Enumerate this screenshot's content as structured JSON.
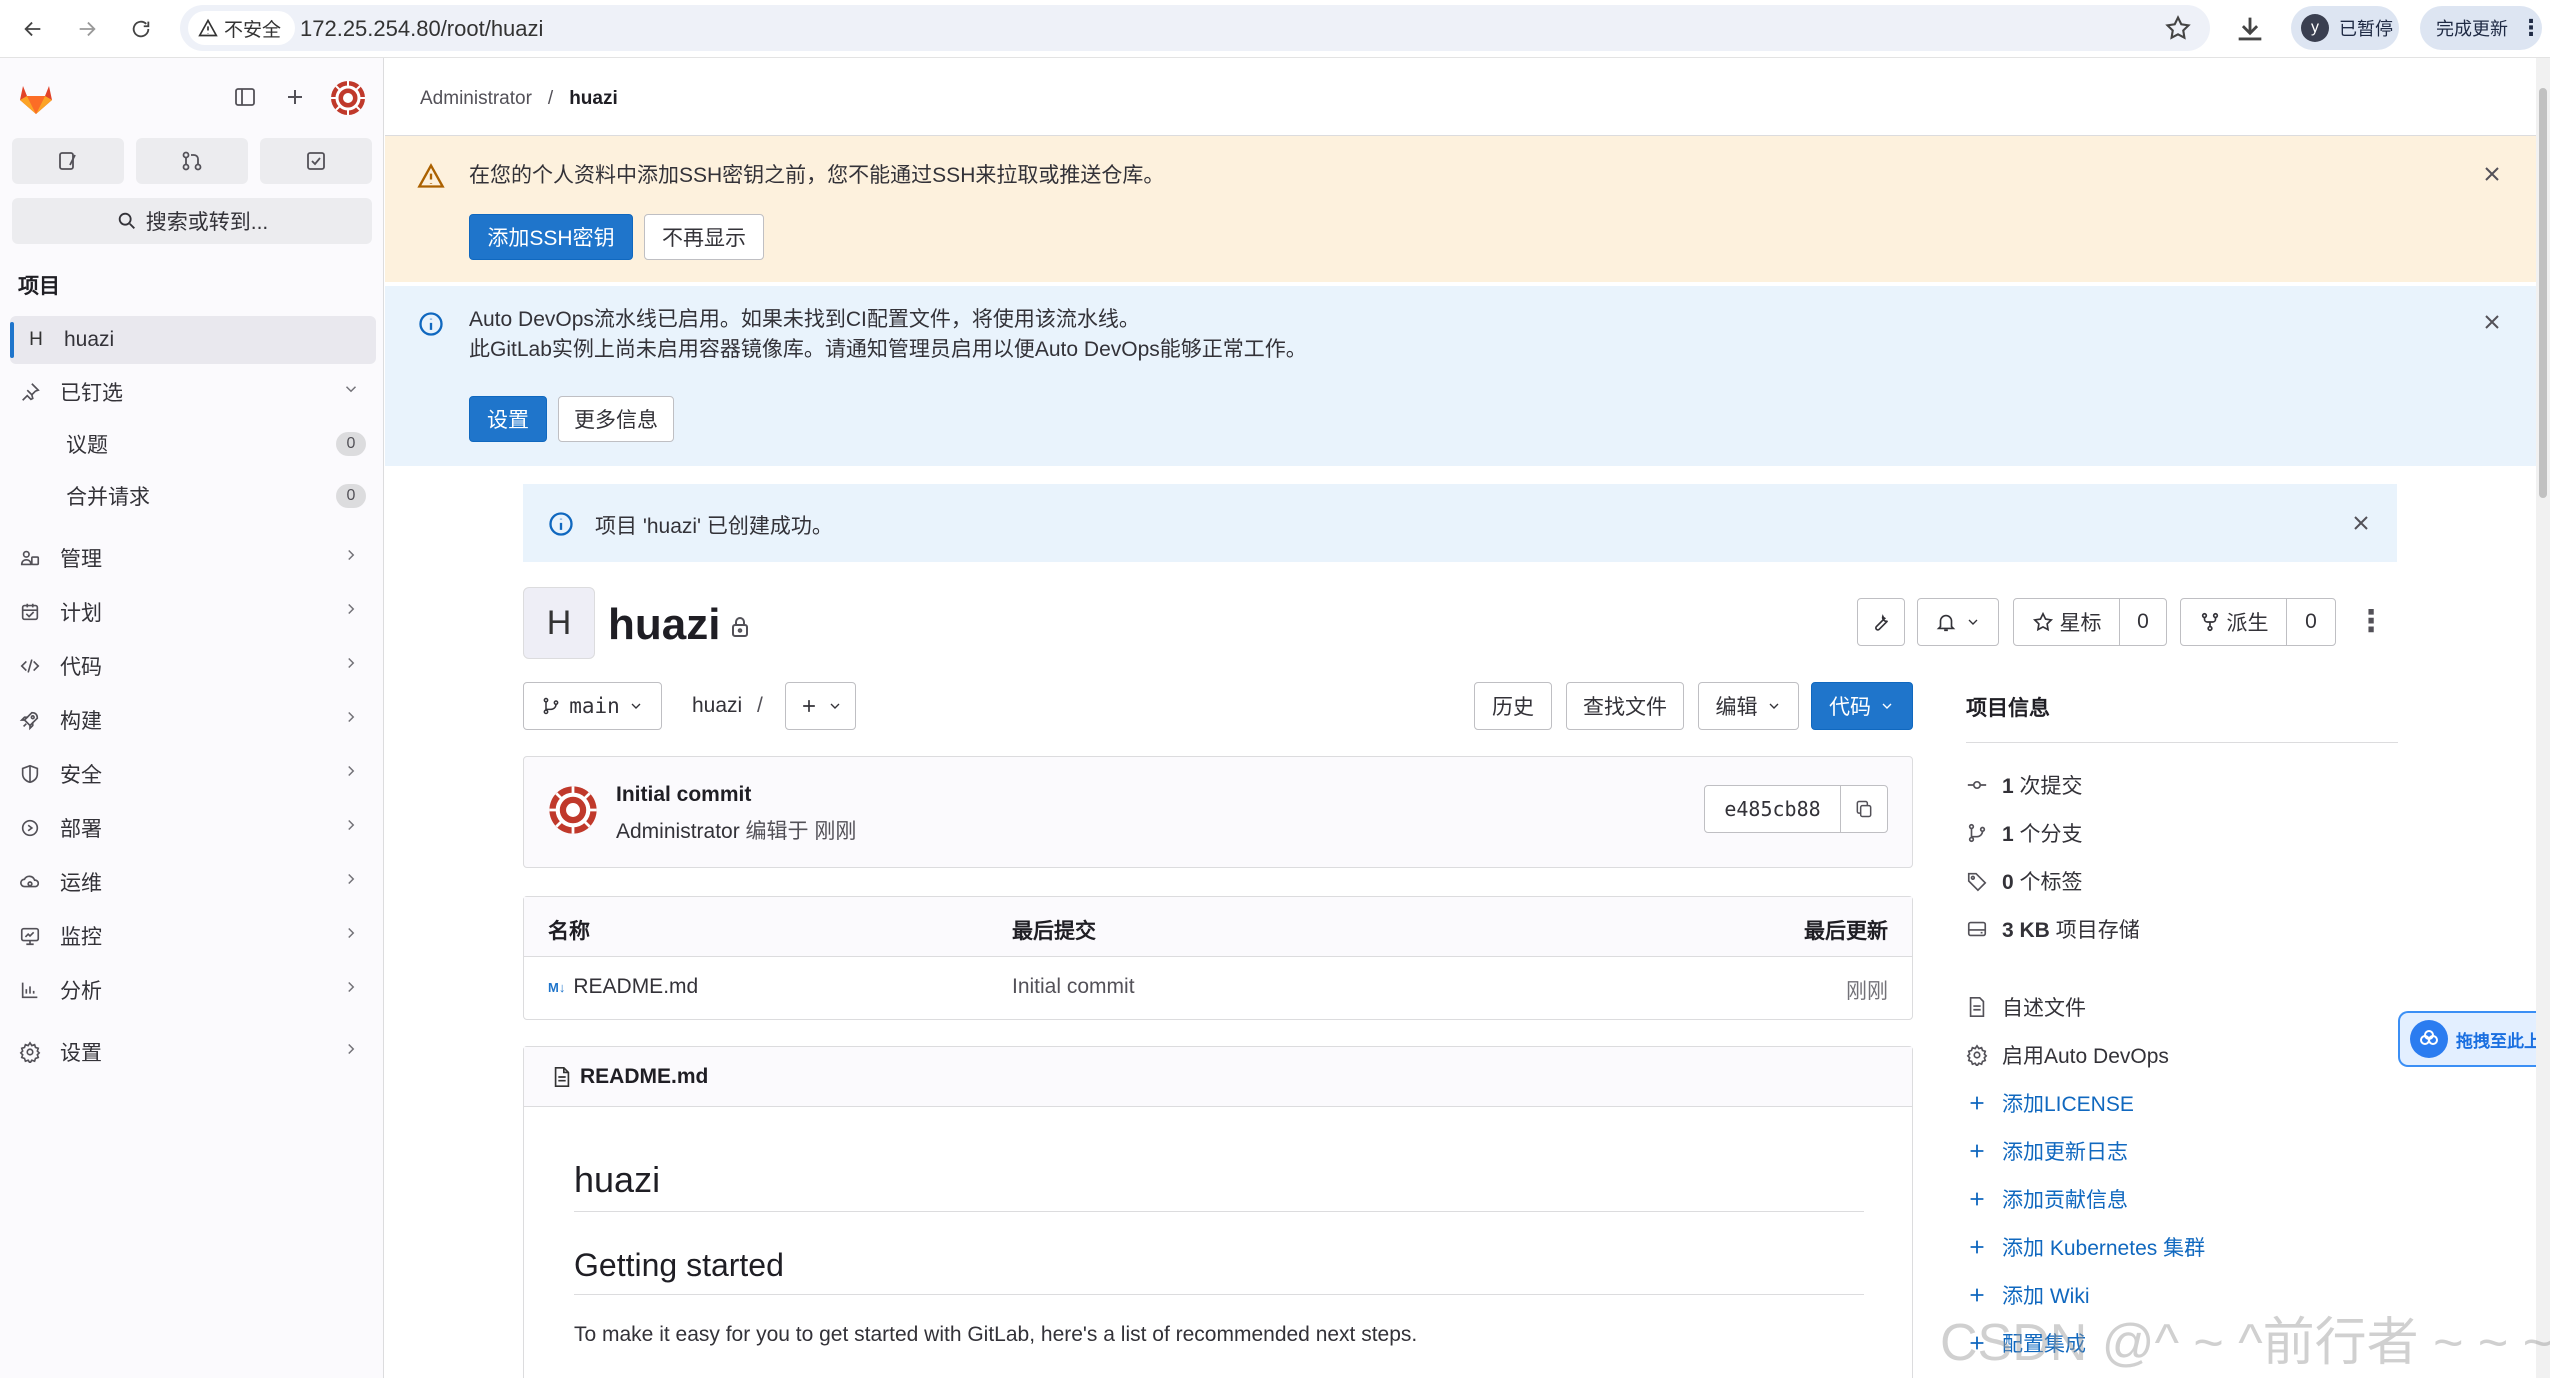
{
  "browser": {
    "security_label": "不安全",
    "url": "172.25.254.80/root/huazi",
    "profile_initial": "y",
    "paused_label": "已暂停",
    "update_label": "完成更新"
  },
  "sidebar": {
    "search_label": "搜索或转到...",
    "section_title": "项目",
    "project": {
      "initial": "H",
      "name": "huazi"
    },
    "pinned_label": "已钉选",
    "pinned_items": [
      {
        "label": "议题",
        "count": "0"
      },
      {
        "label": "合并请求",
        "count": "0"
      }
    ],
    "nav_items": [
      {
        "label": "管理",
        "icon": "users-icon"
      },
      {
        "label": "计划",
        "icon": "calendar-icon"
      },
      {
        "label": "代码",
        "icon": "code-icon"
      },
      {
        "label": "构建",
        "icon": "rocket-icon"
      },
      {
        "label": "安全",
        "icon": "shield-icon"
      },
      {
        "label": "部署",
        "icon": "deploy-icon"
      },
      {
        "label": "运维",
        "icon": "cloud-gear-icon"
      },
      {
        "label": "监控",
        "icon": "monitor-icon"
      },
      {
        "label": "分析",
        "icon": "chart-icon"
      },
      {
        "label": "设置",
        "icon": "gear-icon"
      }
    ]
  },
  "breadcrumb": {
    "parent": "Administrator",
    "separator": "/",
    "current": "huazi"
  },
  "alerts": {
    "ssh": {
      "text": "在您的个人资料中添加SSH密钥之前，您不能通过SSH来拉取或推送仓库。",
      "primary_btn": "添加SSH密钥",
      "secondary_btn": "不再显示"
    },
    "devops": {
      "line1": "Auto DevOps流水线已启用。如果未找到CI配置文件，将使用该流水线。",
      "line2": "此GitLab实例上尚未启用容器镜像库。请通知管理员启用以便Auto DevOps能够正常工作。",
      "primary_btn": "设置",
      "secondary_btn": "更多信息"
    },
    "flash": "项目 'huazi' 已创建成功。"
  },
  "project": {
    "initial": "H",
    "name": "huazi",
    "star_label": "星标",
    "star_count": "0",
    "fork_label": "派生",
    "fork_count": "0"
  },
  "toolbar": {
    "branch": "main",
    "path": "huazi",
    "path_sep": "/",
    "history": "历史",
    "find_file": "查找文件",
    "edit": "编辑",
    "code": "代码"
  },
  "commit": {
    "title": "Initial commit",
    "author": "Administrator",
    "meta": "编辑于 刚刚",
    "sha": "e485cb88"
  },
  "files": {
    "headers": [
      "名称",
      "最后提交",
      "最后更新"
    ],
    "rows": [
      {
        "name": "README.md",
        "commit": "Initial commit",
        "updated": "刚刚"
      }
    ]
  },
  "readme": {
    "filename": "README.md",
    "h1": "huazi",
    "h2": "Getting started",
    "p": "To make it easy for you to get started with GitLab, here's a list of recommended next steps."
  },
  "project_info": {
    "title": "项目信息",
    "stats": [
      {
        "value": "1",
        "label": "次提交"
      },
      {
        "value": "1",
        "label": "个分支"
      },
      {
        "value": "0",
        "label": "个标签"
      },
      {
        "value": "3 KB",
        "label": "项目存储"
      }
    ],
    "readme_link": "自述文件",
    "devops_link": "启用Auto DevOps",
    "add_links": [
      "添加LICENSE",
      "添加更新日志",
      "添加贡献信息",
      "添加 Kubernetes 集群",
      "添加 Wiki",
      "配置集成"
    ]
  },
  "drag_widget": {
    "label": "拖拽至此上传"
  },
  "watermark": "CSDN @^ ~ ^前行者 ~ ~ ~"
}
